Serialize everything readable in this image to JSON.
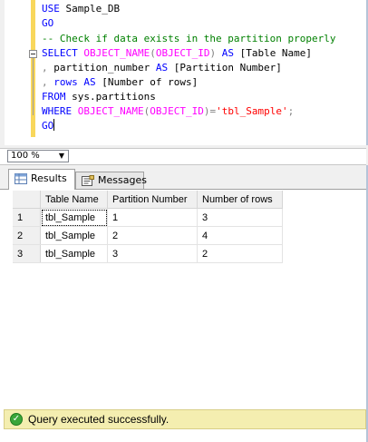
{
  "editor": {
    "lines": [
      {
        "tokens": [
          {
            "t": "USE ",
            "c": "kw"
          },
          {
            "t": "Sample_DB",
            "c": ""
          }
        ]
      },
      {
        "tokens": [
          {
            "t": "GO",
            "c": "kw"
          }
        ]
      },
      {
        "tokens": [
          {
            "t": "-- Check if data exists in the partition properly",
            "c": "cm"
          }
        ]
      },
      {
        "tokens": [
          {
            "t": "SELECT ",
            "c": "kw"
          },
          {
            "t": "OBJECT_NAME",
            "c": "fn"
          },
          {
            "t": "(",
            "c": "gr"
          },
          {
            "t": "OBJECT_ID",
            "c": "fn"
          },
          {
            "t": ")",
            "c": "gr"
          },
          {
            "t": " AS ",
            "c": "kw"
          },
          {
            "t": "[Table Name]",
            "c": ""
          }
        ]
      },
      {
        "tokens": [
          {
            "t": ", ",
            "c": "gr"
          },
          {
            "t": "partition_number ",
            "c": ""
          },
          {
            "t": "AS ",
            "c": "kw"
          },
          {
            "t": "[Partition Number]",
            "c": ""
          }
        ]
      },
      {
        "tokens": [
          {
            "t": ", ",
            "c": "gr"
          },
          {
            "t": "rows ",
            "c": "kw"
          },
          {
            "t": "AS ",
            "c": "kw"
          },
          {
            "t": "[Number of rows]",
            "c": ""
          }
        ]
      },
      {
        "tokens": [
          {
            "t": "FROM ",
            "c": "kw"
          },
          {
            "t": "sys.partitions",
            "c": ""
          }
        ]
      },
      {
        "tokens": [
          {
            "t": "WHERE ",
            "c": "kw"
          },
          {
            "t": "OBJECT_NAME",
            "c": "fn"
          },
          {
            "t": "(",
            "c": "gr"
          },
          {
            "t": "OBJECT_ID",
            "c": "fn"
          },
          {
            "t": ")=",
            "c": "gr"
          },
          {
            "t": "'tbl_Sample'",
            "c": "str"
          },
          {
            "t": ";",
            "c": "gr"
          }
        ]
      },
      {
        "tokens": [
          {
            "t": "GO",
            "c": "kw"
          }
        ]
      }
    ]
  },
  "zoom": {
    "value": "100 %"
  },
  "tabs": {
    "results_label": "Results",
    "messages_label": "Messages"
  },
  "results": {
    "columns": [
      "Table Name",
      "Partition Number",
      "Number of rows"
    ],
    "rows": [
      {
        "num": "1",
        "cells": [
          "tbl_Sample",
          "1",
          "3"
        ]
      },
      {
        "num": "2",
        "cells": [
          "tbl_Sample",
          "2",
          "4"
        ]
      },
      {
        "num": "3",
        "cells": [
          "tbl_Sample",
          "3",
          "2"
        ]
      }
    ]
  },
  "status": {
    "text": "Query executed successfully.",
    "color": "#f4eeb0"
  },
  "colors": {
    "keyword": "#0000ff",
    "function": "#ff00ff",
    "string": "#ff0000",
    "comment": "#008000",
    "operator": "#808080"
  }
}
